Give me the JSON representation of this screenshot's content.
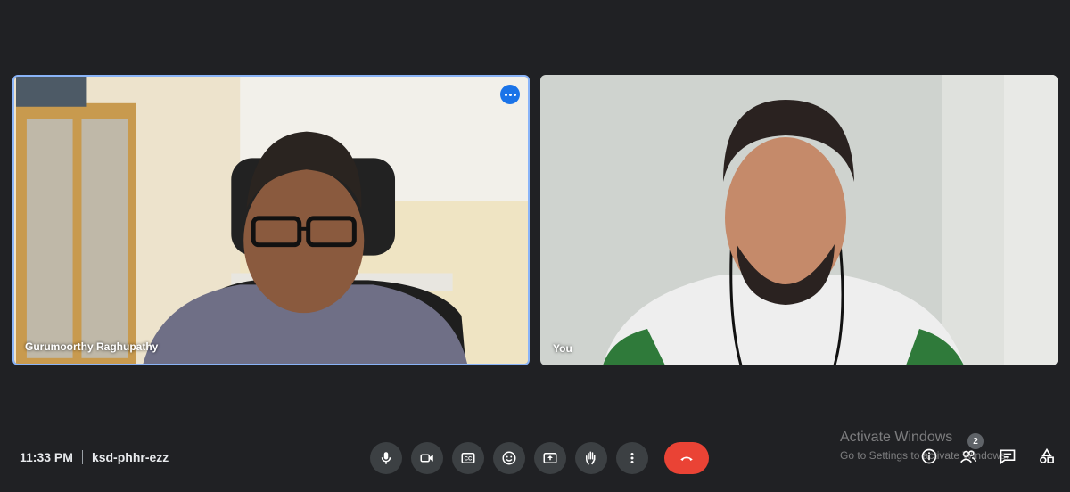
{
  "participants": [
    {
      "name": "Gurumoorthy Raghupathy",
      "active_speaker": true
    },
    {
      "name": "You",
      "active_speaker": false
    }
  ],
  "meeting": {
    "time": "11:33 PM",
    "code": "ksd-phhr-ezz"
  },
  "controls": [
    {
      "icon": "microphone-icon"
    },
    {
      "icon": "camera-icon"
    },
    {
      "icon": "captions-icon"
    },
    {
      "icon": "emoji-icon"
    },
    {
      "icon": "present-screen-icon"
    },
    {
      "icon": "raise-hand-icon"
    },
    {
      "icon": "more-options-icon"
    },
    {
      "icon": "end-call-icon"
    }
  ],
  "right_panel": {
    "people_count": "2",
    "icons": [
      "info-icon",
      "people-icon",
      "chat-icon",
      "activities-icon"
    ]
  },
  "watermark": {
    "title": "Activate Windows",
    "subtitle": "Go to Settings to activate Windows."
  },
  "colors": {
    "accent": "#8ab4f8",
    "end_call": "#ea4335",
    "background": "#202124"
  }
}
